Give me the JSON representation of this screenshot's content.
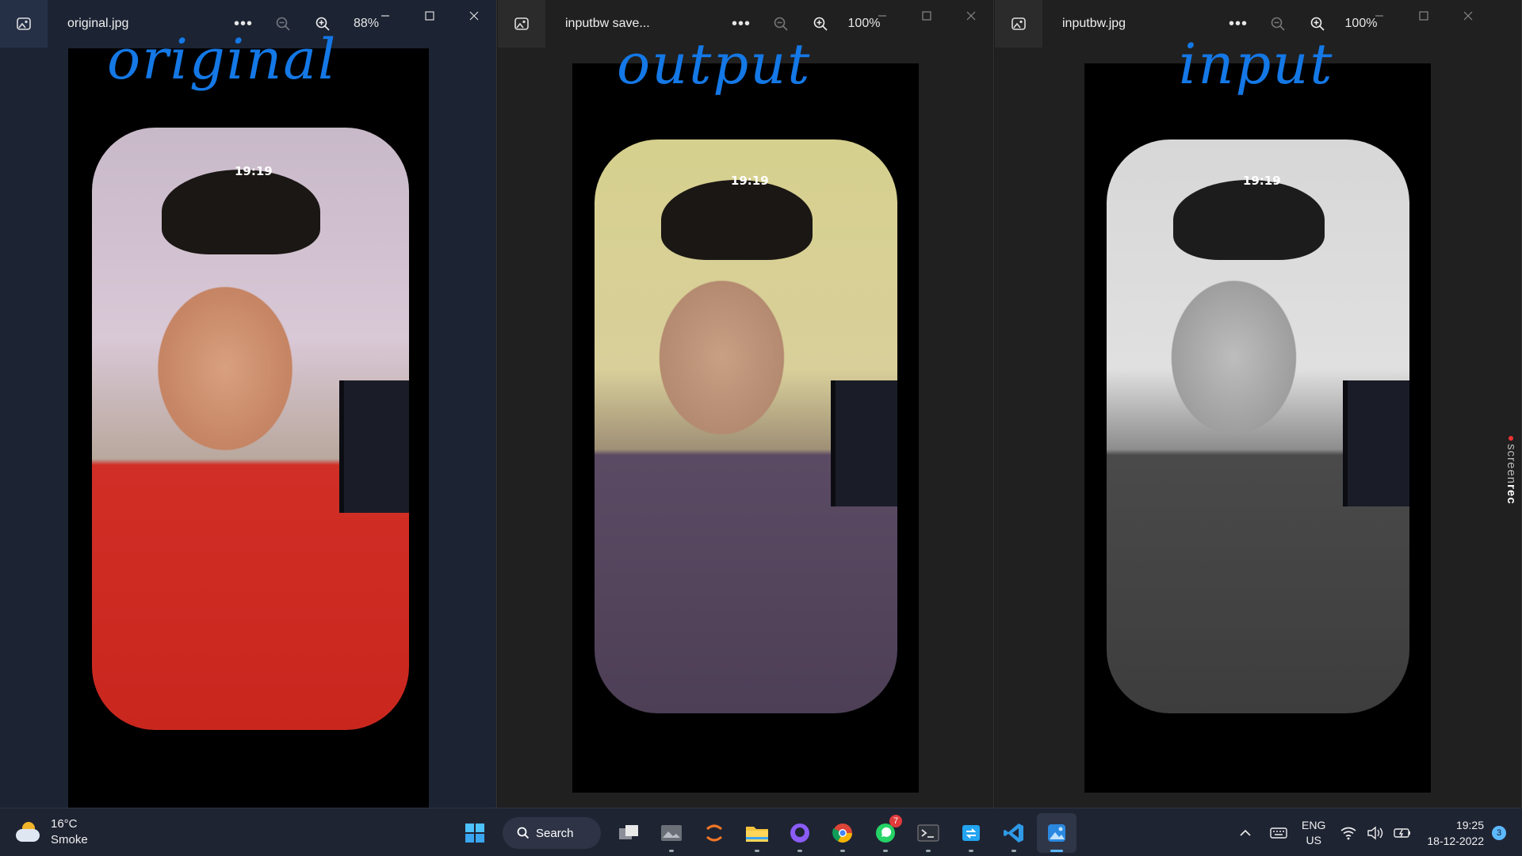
{
  "windows": [
    {
      "title": "original.jpg",
      "zoom": "88%",
      "note": "original"
    },
    {
      "title": "inputbw save...",
      "zoom": "100%",
      "note": "output"
    },
    {
      "title": "inputbw.jpg",
      "zoom": "100%",
      "note": "input"
    }
  ],
  "photo_clock": "19:19",
  "screenrec": {
    "a": "screen",
    "b": "rec"
  },
  "taskbar": {
    "weather": {
      "temp": "16°C",
      "condition": "Smoke"
    },
    "search_label": "Search",
    "whatsapp_badge": "7",
    "lang_top": "ENG",
    "lang_bottom": "US",
    "time": "19:25",
    "date": "18-12-2022",
    "notifications": "3"
  },
  "colors": {
    "accent": "#5cb8ff",
    "ink": "#1478e6",
    "taskbar": "#1f2433"
  }
}
